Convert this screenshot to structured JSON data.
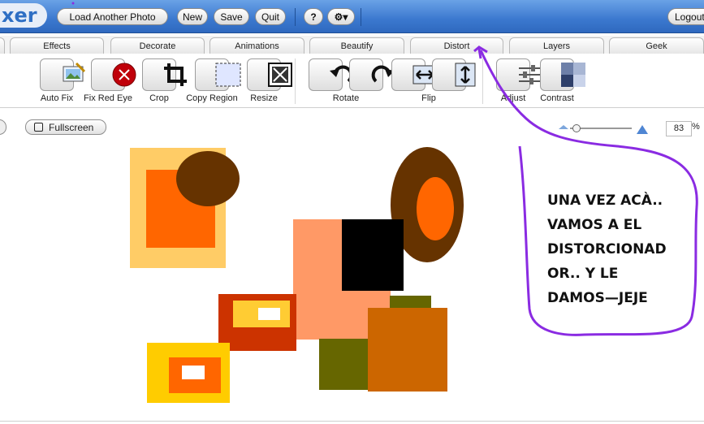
{
  "app": {
    "logo_text": "xer"
  },
  "topbar": {
    "load_another_photo": "Load Another Photo",
    "new": "New",
    "save": "Save",
    "quit": "Quit",
    "help": "?",
    "settings": "⚙▾",
    "logout": "Logout"
  },
  "tabs": [
    "Effects",
    "Decorate",
    "Animations",
    "Beautify",
    "Distort",
    "Layers",
    "Geek"
  ],
  "tools": {
    "auto_fix": "Auto Fix",
    "fix_red_eye": "Fix Red Eye",
    "crop": "Crop",
    "copy_region": "Copy Region",
    "resize": "Resize",
    "rotate": "Rotate",
    "flip": "Flip",
    "adjust": "Adjust",
    "contrast": "Contrast"
  },
  "view": {
    "fullscreen": "Fullscreen",
    "zoom_value": "83",
    "zoom_unit": "%"
  },
  "annotation": {
    "lines": [
      "UNA VEZ ACÀ..",
      "VAMOS A EL",
      "DISTORCIONAD",
      "OR.. Y LE",
      "DAMOS—JEJE"
    ],
    "color": "#8a2be2"
  },
  "colors": {
    "accent": "#3b78cf"
  }
}
